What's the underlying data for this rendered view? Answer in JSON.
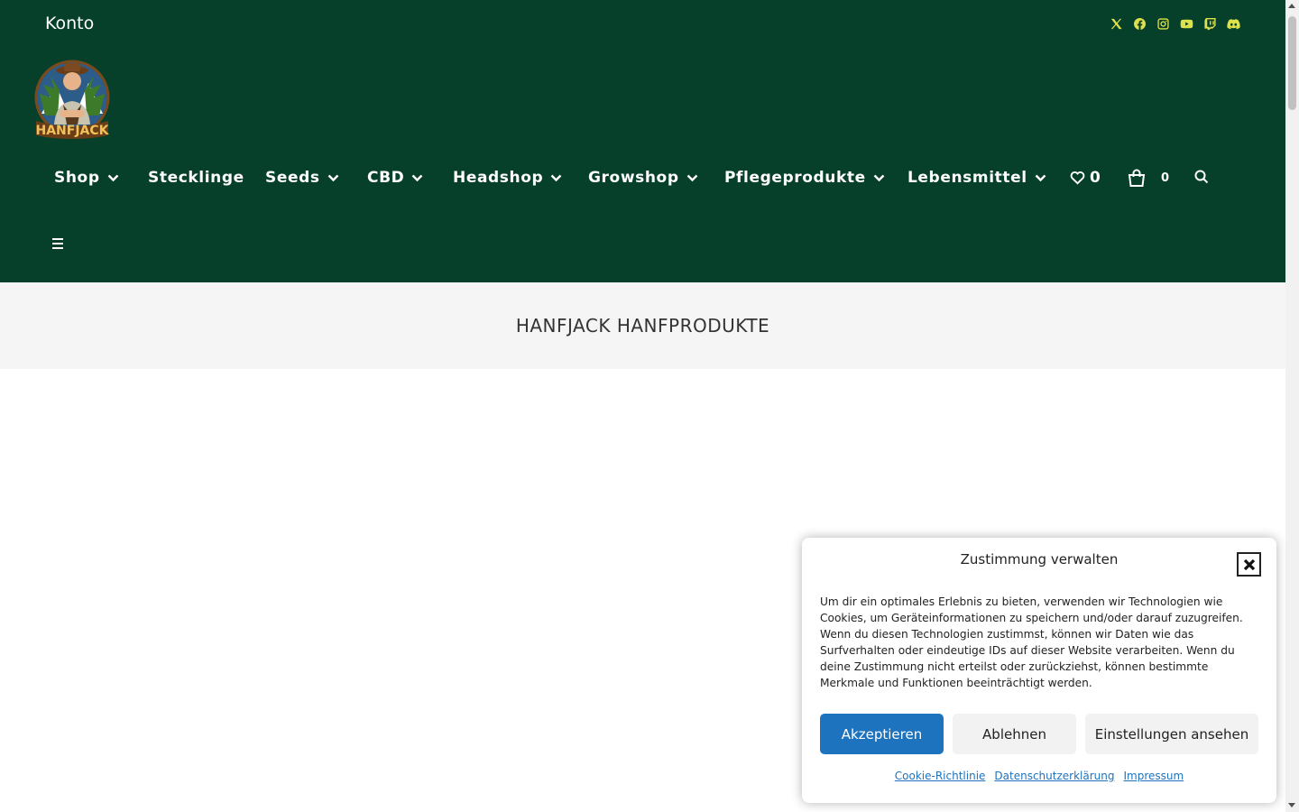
{
  "colors": {
    "header_bg": "#06402b",
    "social_icon": "#dfe14a",
    "accept_button": "#1e73be",
    "title_band_bg": "#f5f5f5"
  },
  "topbar": {
    "account_link": "Konto",
    "social_icons": [
      "x-icon",
      "facebook-icon",
      "instagram-icon",
      "youtube-icon",
      "twitch-icon",
      "discord-icon"
    ]
  },
  "logo": {
    "text": "HANFJACK"
  },
  "nav": {
    "items": [
      {
        "label": "Shop",
        "has_dropdown": true
      },
      {
        "label": "Stecklinge",
        "has_dropdown": false
      },
      {
        "label": "Seeds",
        "has_dropdown": true
      },
      {
        "label": "CBD",
        "has_dropdown": true
      },
      {
        "label": "Headshop",
        "has_dropdown": true
      },
      {
        "label": "Growshop",
        "has_dropdown": true
      },
      {
        "label": "Pflegeprodukte",
        "has_dropdown": true
      },
      {
        "label": "Lebensmittel",
        "has_dropdown": true
      }
    ],
    "wishlist_count": "0",
    "cart_count": "0"
  },
  "page": {
    "title": "HANFJACK HANFPRODUKTE"
  },
  "cookie": {
    "title": "Zustimmung verwalten",
    "text": "Um dir ein optimales Erlebnis zu bieten, verwenden wir Technologien wie Cookies, um Geräteinformationen zu speichern und/oder darauf zuzugreifen. Wenn du diesen Technologien zustimmst, können wir Daten wie das Surfverhalten oder eindeutige IDs auf dieser Website verarbeiten. Wenn du deine Zustimmung nicht erteilst oder zurückziehst, können bestimmte Merkmale und Funktionen beeinträchtigt werden.",
    "accept": "Akzeptieren",
    "deny": "Ablehnen",
    "settings": "Einstellungen ansehen",
    "links": [
      "Cookie-Richtlinie",
      "Datenschutzerklärung",
      "Impressum"
    ]
  }
}
